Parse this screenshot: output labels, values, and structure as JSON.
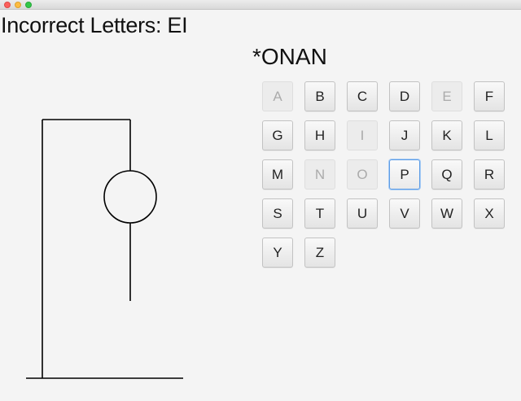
{
  "window": {
    "traffic_lights": [
      "close",
      "minimize",
      "zoom"
    ]
  },
  "incorrect_letters": "Incorrect Letters: EI",
  "word_display": "*ONAN",
  "keyboard": {
    "keys": [
      {
        "letter": "A",
        "enabled": false
      },
      {
        "letter": "B",
        "enabled": true
      },
      {
        "letter": "C",
        "enabled": true
      },
      {
        "letter": "D",
        "enabled": true
      },
      {
        "letter": "E",
        "enabled": false
      },
      {
        "letter": "F",
        "enabled": true
      },
      {
        "letter": "G",
        "enabled": true
      },
      {
        "letter": "H",
        "enabled": true
      },
      {
        "letter": "I",
        "enabled": false
      },
      {
        "letter": "J",
        "enabled": true
      },
      {
        "letter": "K",
        "enabled": true
      },
      {
        "letter": "L",
        "enabled": true
      },
      {
        "letter": "M",
        "enabled": true
      },
      {
        "letter": "N",
        "enabled": false
      },
      {
        "letter": "O",
        "enabled": false
      },
      {
        "letter": "P",
        "enabled": true,
        "focused": true
      },
      {
        "letter": "Q",
        "enabled": true
      },
      {
        "letter": "R",
        "enabled": true
      },
      {
        "letter": "S",
        "enabled": true
      },
      {
        "letter": "T",
        "enabled": true
      },
      {
        "letter": "U",
        "enabled": true
      },
      {
        "letter": "V",
        "enabled": true
      },
      {
        "letter": "W",
        "enabled": true
      },
      {
        "letter": "X",
        "enabled": true
      },
      {
        "letter": "Y",
        "enabled": true
      },
      {
        "letter": "Z",
        "enabled": true
      }
    ]
  },
  "hangman": {
    "parts_shown": [
      "base",
      "pole",
      "beam",
      "rope",
      "head",
      "body"
    ]
  },
  "colors": {
    "background": "#f4f4f4",
    "stroke": "#000000",
    "focus_ring": "#5c9ce6",
    "disabled_text": "#ababab"
  }
}
